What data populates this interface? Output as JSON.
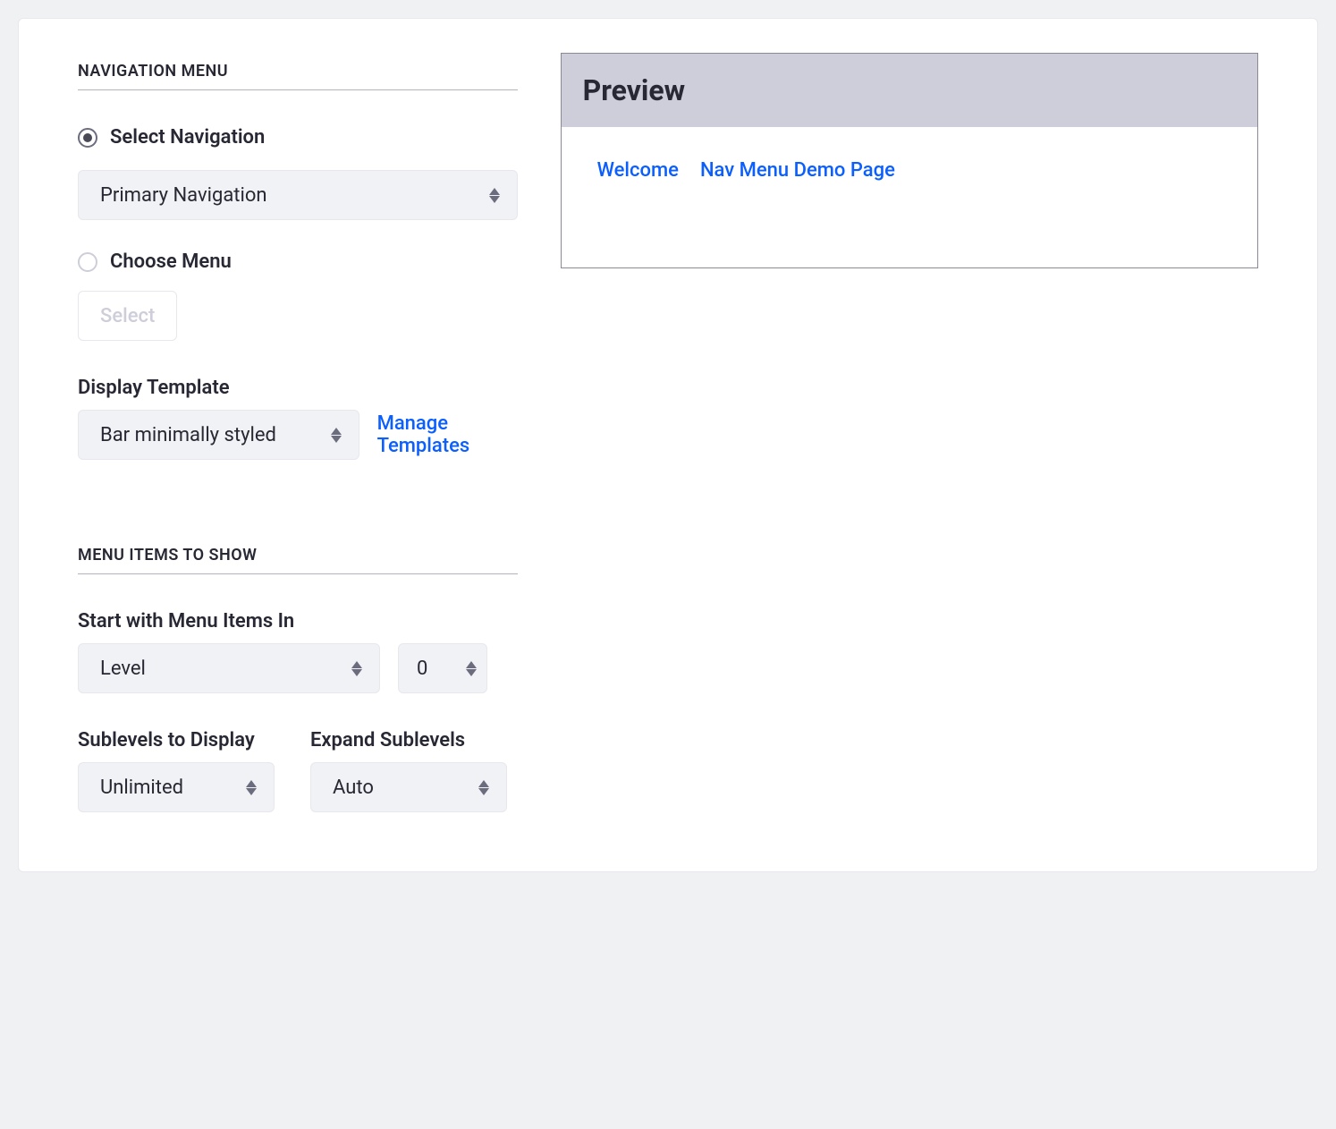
{
  "section1": {
    "title": "NAVIGATION MENU",
    "radio_select_nav": "Select Navigation",
    "select_nav_value": "Primary Navigation",
    "radio_choose_menu": "Choose Menu",
    "choose_menu_button": "Select",
    "display_template_label": "Display Template",
    "display_template_value": "Bar minimally styled",
    "manage_templates_link": "Manage Templates"
  },
  "section2": {
    "title": "MENU ITEMS TO SHOW",
    "start_label": "Start with Menu Items In",
    "start_select_value": "Level",
    "start_number_value": "0",
    "sublevels_label": "Sublevels to Display",
    "sublevels_value": "Unlimited",
    "expand_label": "Expand Sublevels",
    "expand_value": "Auto"
  },
  "preview": {
    "title": "Preview",
    "links": [
      "Welcome",
      "Nav Menu Demo Page"
    ]
  }
}
